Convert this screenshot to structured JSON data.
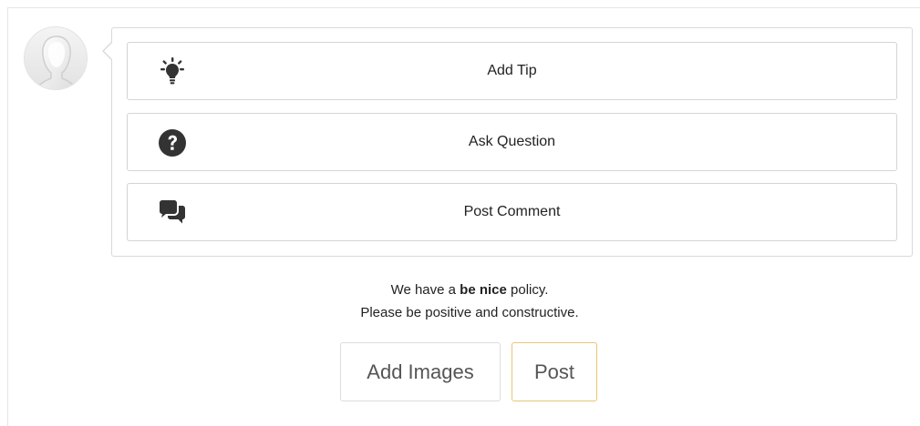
{
  "avatar": {
    "icon": "default-user-silhouette-icon"
  },
  "actions": [
    {
      "label": "Add Tip",
      "icon": "lightbulb-icon"
    },
    {
      "label": "Ask Question",
      "icon": "question-circle-icon"
    },
    {
      "label": "Post Comment",
      "icon": "chat-bubbles-icon"
    }
  ],
  "policy": {
    "line1_prefix": "We have a ",
    "line1_bold": "be nice",
    "line1_suffix": " policy.",
    "line2": "Please be positive and constructive."
  },
  "buttons": {
    "add_images": "Add Images",
    "post": "Post"
  },
  "colors": {
    "icon": "#333333",
    "post_border": "#e8c674",
    "border": "#d4d4d4"
  }
}
